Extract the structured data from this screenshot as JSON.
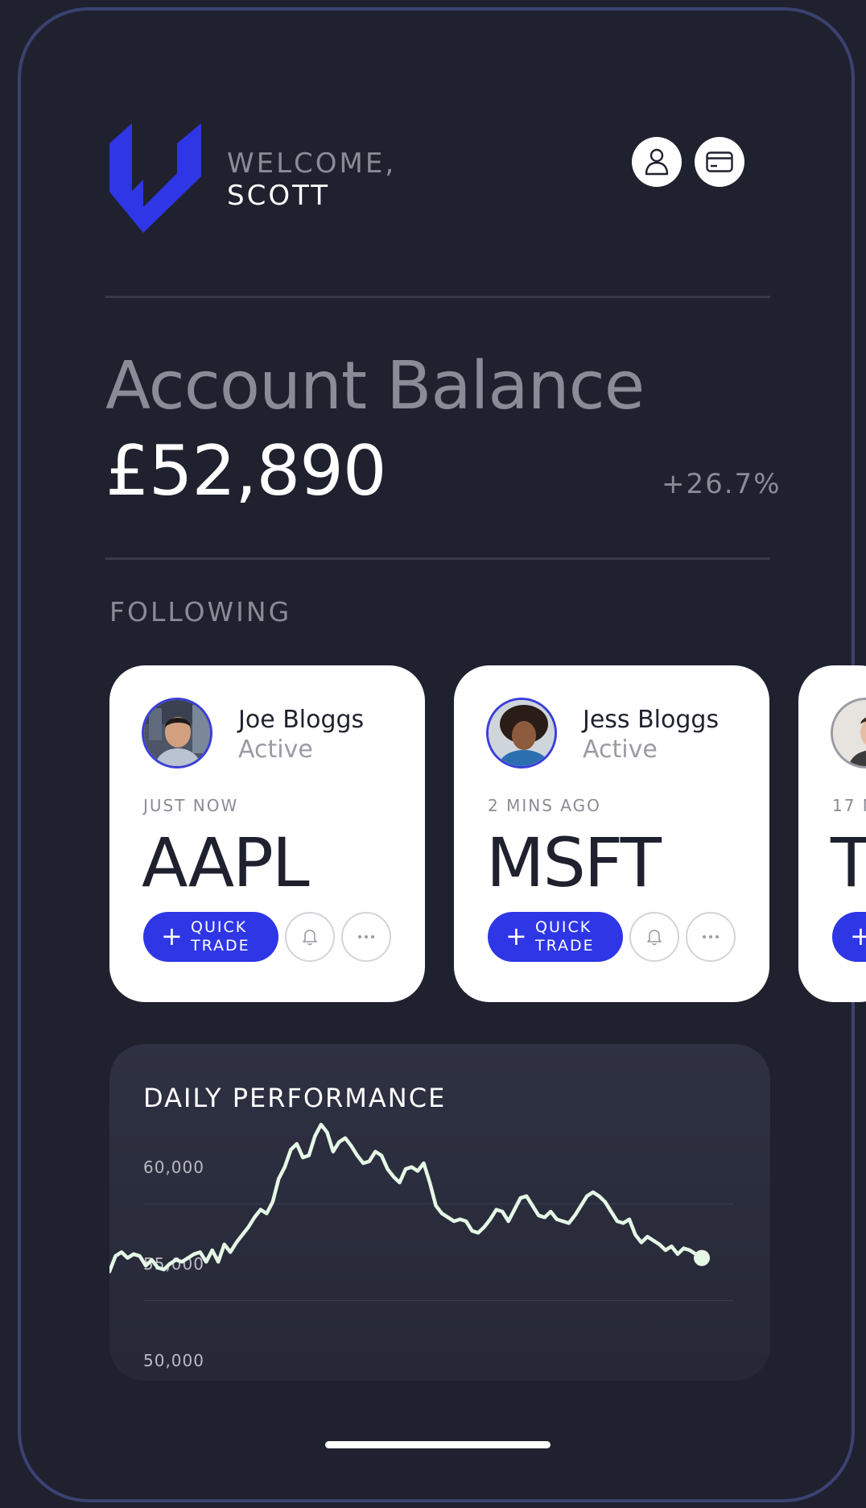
{
  "header": {
    "welcome": "WELCOME,",
    "user_name": "SCOTT",
    "brand_color": "#2e36e6"
  },
  "balance": {
    "title": "Account Balance",
    "value": "£52,890",
    "change": "+26.7%"
  },
  "following": {
    "label": "FOLLOWING",
    "cards": [
      {
        "name": "Joe Bloggs",
        "status": "Active",
        "time": "JUST NOW",
        "ticker": "AAPL",
        "button_plus": "+",
        "button_line1": "QUICK",
        "button_line2": "TRADE"
      },
      {
        "name": "Jess Bloggs",
        "status": "Active",
        "time": "2 MINS AGO",
        "ticker": "MSFT",
        "button_plus": "+",
        "button_line1": "QUICK",
        "button_line2": "TRADE"
      },
      {
        "time": "17 M",
        "ticker": "T",
        "button_plus": "+"
      }
    ]
  },
  "performance": {
    "title": "DAILY PERFORMANCE"
  },
  "chart_data": {
    "type": "line",
    "title": "DAILY PERFORMANCE",
    "ylim": [
      50000,
      60000
    ],
    "yticks": [
      "60,000",
      "55,000",
      "50,000"
    ],
    "series": [
      {
        "values": [
          52400,
          53200,
          53400,
          53100,
          53300,
          53200,
          52700,
          53000,
          52600,
          52500,
          52800,
          53000,
          52900,
          53100,
          53300,
          53400,
          52900,
          53500,
          52900,
          53800,
          53400,
          53900,
          54300,
          54700,
          55200,
          55600,
          55400,
          56000,
          57200,
          57800,
          58700,
          59000,
          58300,
          58400,
          59400,
          60000,
          59600,
          58600,
          59100,
          59300,
          58900,
          58400,
          58000,
          58100,
          58600,
          58400,
          57700,
          57300,
          57000,
          57700,
          57800,
          57600,
          58000,
          57000,
          55800,
          55400,
          55200,
          55000,
          55100,
          55000,
          54500,
          54400,
          54700,
          55100,
          55600,
          55500,
          55000,
          55600,
          56200,
          56300,
          55800,
          55300,
          55200,
          55500,
          55100,
          55000,
          54900,
          55300,
          55800,
          56300,
          56500,
          56300,
          56000,
          55500,
          55000,
          54900,
          55100,
          54300,
          53900,
          54200,
          54000,
          53800,
          53500,
          53700,
          53300,
          53600,
          53500,
          53300,
          53100
        ]
      }
    ],
    "grid": true,
    "line_color": "#e5f8e6"
  },
  "icons": [
    "logo-icon",
    "profile-icon",
    "card-icon",
    "bell-icon",
    "more-icon"
  ]
}
